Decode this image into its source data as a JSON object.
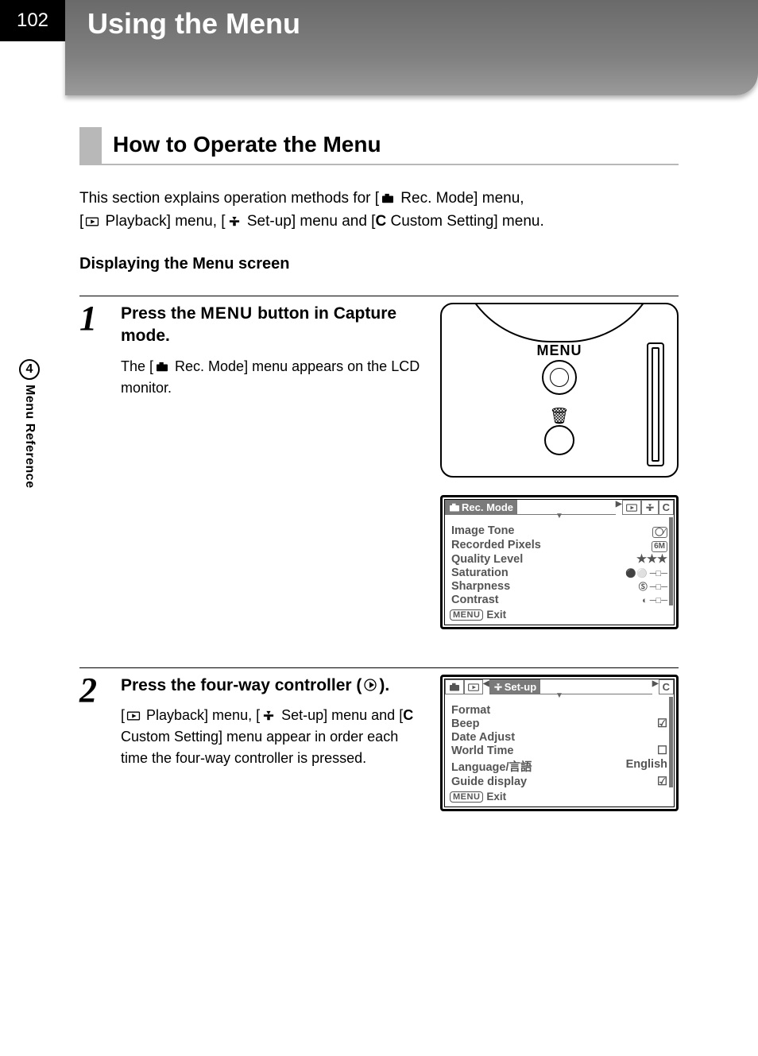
{
  "page_number": "102",
  "chapter_title": "Using the Menu",
  "side_tab": {
    "num": "4",
    "text": "Menu Reference"
  },
  "section_title": "How to Operate the Menu",
  "intro": {
    "t1": "This section explains operation methods for [",
    "rec": " Rec. Mode] menu,",
    "t2": "[",
    "play": " Playback] menu, [",
    "setup": " Set-up] menu and [",
    "custom_letter": "C",
    "custom": " Custom Setting] menu."
  },
  "subhead": "Displaying the Menu screen",
  "steps": [
    {
      "num": "1",
      "title_a": "Press the ",
      "title_menu": "MENU",
      "title_b": " button in Capture mode.",
      "desc_a": "The [",
      "desc_b": " Rec. Mode] menu appears on the LCD monitor.",
      "cam_menu_label": "MENU",
      "lcd": {
        "active_tab_label": "Rec. Mode",
        "tab_c": "C",
        "rows": [
          {
            "k": "Image Tone",
            "v_type": "tone"
          },
          {
            "k": "Recorded Pixels",
            "v_type": "pix",
            "v": "6M"
          },
          {
            "k": "Quality Level",
            "v_type": "stars",
            "v": "★★★"
          },
          {
            "k": "Saturation",
            "v_type": "slider"
          },
          {
            "k": "Sharpness",
            "v_type": "slider_s"
          },
          {
            "k": "Contrast",
            "v_type": "slider_c"
          }
        ],
        "exit": "Exit"
      }
    },
    {
      "num": "2",
      "title_a": "Press the four-way controller (",
      "title_b": ").",
      "desc_a": "[",
      "desc_play": " Playback] menu, [",
      "desc_setup": " Set-up] menu and [",
      "desc_c_letter": "C",
      "desc_c": " Custom Setting] menu appear in order each time the four-way controller is pressed.",
      "lcd": {
        "active_tab_label": " Set-up",
        "tab_c": "C",
        "rows": [
          {
            "k": "Format",
            "v": ""
          },
          {
            "k": "Beep",
            "v": "☑"
          },
          {
            "k": "Date Adjust",
            "v": ""
          },
          {
            "k": "World Time",
            "v": "☐"
          },
          {
            "k": "Language/言語",
            "v": "English"
          },
          {
            "k": "Guide display",
            "v": "☑"
          }
        ],
        "exit": "Exit"
      }
    }
  ]
}
